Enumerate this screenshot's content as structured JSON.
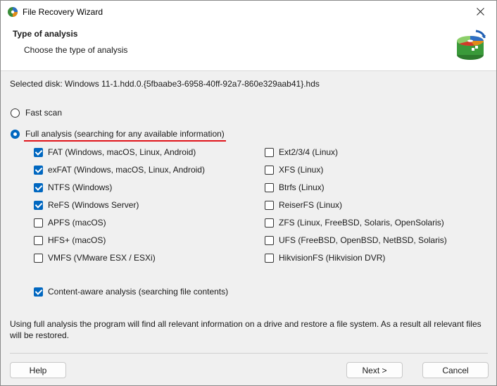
{
  "window": {
    "title": "File Recovery Wizard"
  },
  "header": {
    "title": "Type of analysis",
    "subtitle": "Choose the type of analysis"
  },
  "selected_disk": "Selected disk: Windows 11-1.hdd.0.{5fbaabe3-6958-40ff-92a7-860e329aab41}.hds",
  "scan_options": [
    {
      "label": "Fast scan",
      "selected": false
    },
    {
      "label": "Full analysis (searching for any available information)",
      "selected": true
    }
  ],
  "filesystems_left": [
    {
      "label": "FAT (Windows, macOS, Linux, Android)",
      "checked": true
    },
    {
      "label": "exFAT (Windows, macOS, Linux, Android)",
      "checked": true
    },
    {
      "label": "NTFS (Windows)",
      "checked": true
    },
    {
      "label": "ReFS (Windows Server)",
      "checked": true
    },
    {
      "label": "APFS (macOS)",
      "checked": false
    },
    {
      "label": "HFS+ (macOS)",
      "checked": false
    },
    {
      "label": "VMFS (VMware ESX / ESXi)",
      "checked": false
    }
  ],
  "filesystems_right": [
    {
      "label": "Ext2/3/4 (Linux)",
      "checked": false
    },
    {
      "label": "XFS (Linux)",
      "checked": false
    },
    {
      "label": "Btrfs (Linux)",
      "checked": false
    },
    {
      "label": "ReiserFS (Linux)",
      "checked": false
    },
    {
      "label": "ZFS (Linux, FreeBSD, Solaris, OpenSolaris)",
      "checked": false
    },
    {
      "label": "UFS (FreeBSD, OpenBSD, NetBSD, Solaris)",
      "checked": false
    },
    {
      "label": "HikvisionFS (Hikvision DVR)",
      "checked": false
    }
  ],
  "content_aware": {
    "label": "Content-aware analysis (searching file contents)",
    "checked": true
  },
  "info_text": "Using full analysis the program will find all relevant information on a drive and restore a file system. As a result all relevant files will be restored.",
  "buttons": {
    "help": "Help",
    "next": "Next >",
    "cancel": "Cancel"
  },
  "icons": {
    "app": "file-recovery-app-icon",
    "close": "close-icon",
    "header_logo": "disk-recovery-logo-icon"
  },
  "colors": {
    "accent": "#0067c0",
    "highlight_underline": "#e0141b"
  }
}
